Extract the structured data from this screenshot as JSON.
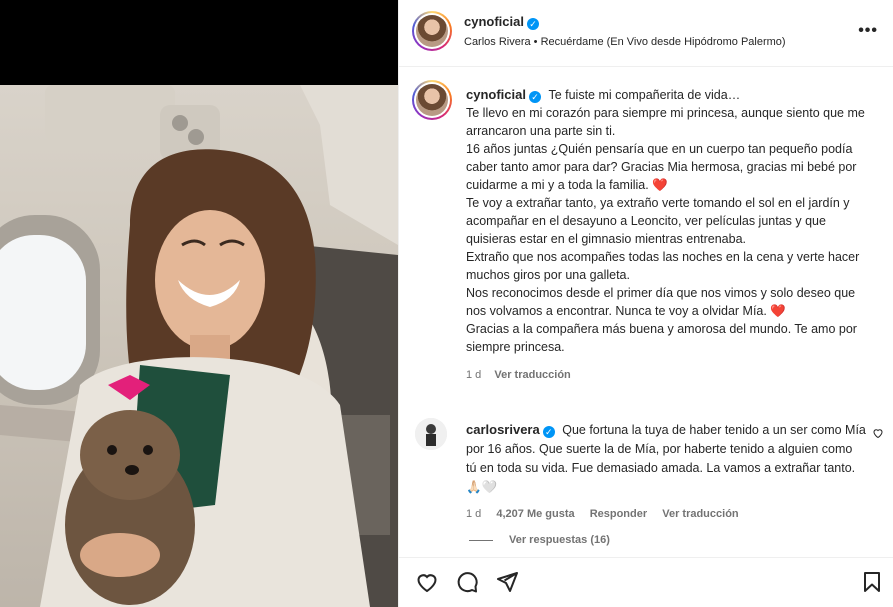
{
  "post_header": {
    "username": "cynoficial",
    "subtitle": "Carlos Rivera • Recuérdame (En Vivo desde Hipódromo Palermo)",
    "more_label": "•••"
  },
  "caption": {
    "username": "cynoficial",
    "lines": [
      "Te fuiste mi compañerita de vida…",
      "Te llevo en mi corazón para siempre mi princesa, aunque siento que me arrancaron una parte sin ti.",
      "16 años juntas ¿Quién pensaría que en un cuerpo tan pequeño podía caber tanto amor para dar? Gracias Mia hermosa, gracias mi bebé por cuidarme a mi y a toda la familia. ❤️",
      "Te voy a extrañar tanto, ya extraño verte tomando el sol en el jardín y acompañar en el desayuno a Leoncito, ver películas juntas y que quisieras estar en el gimnasio mientras entrenaba.",
      "Extraño que nos acompañes todas las noches en la cena y verte hacer muchos giros por una galleta.",
      "Nos reconocimos desde el primer día que nos vimos y solo deseo que nos volvamos a encontrar. Nunca te voy a olvidar Mía. ❤️",
      "Gracias a la compañera más buena y amorosa del mundo. Te amo por siempre princesa."
    ],
    "time": "1 d",
    "translate_label": "Ver traducción"
  },
  "comment": {
    "username": "carlosrivera",
    "text": "Que fortuna la tuya de haber tenido a un ser como Mía por 16 años. Que suerte la de Mía, por haberte tenido a alguien como tú en toda su vida. Fue demasiado amada. La vamos a extrañar tanto. 🙏🏻🤍",
    "time": "1 d",
    "likes": "4,207 Me gusta",
    "reply_label": "Responder",
    "translate_label": "Ver traducción",
    "view_replies": "Ver respuestas (16)"
  },
  "icons": {
    "like": "heart-icon",
    "comment": "comment-icon",
    "share": "share-icon",
    "save": "bookmark-icon"
  },
  "colors": {
    "verified": "#0095f6",
    "heart": "#ed4956",
    "muted": "#737373"
  }
}
